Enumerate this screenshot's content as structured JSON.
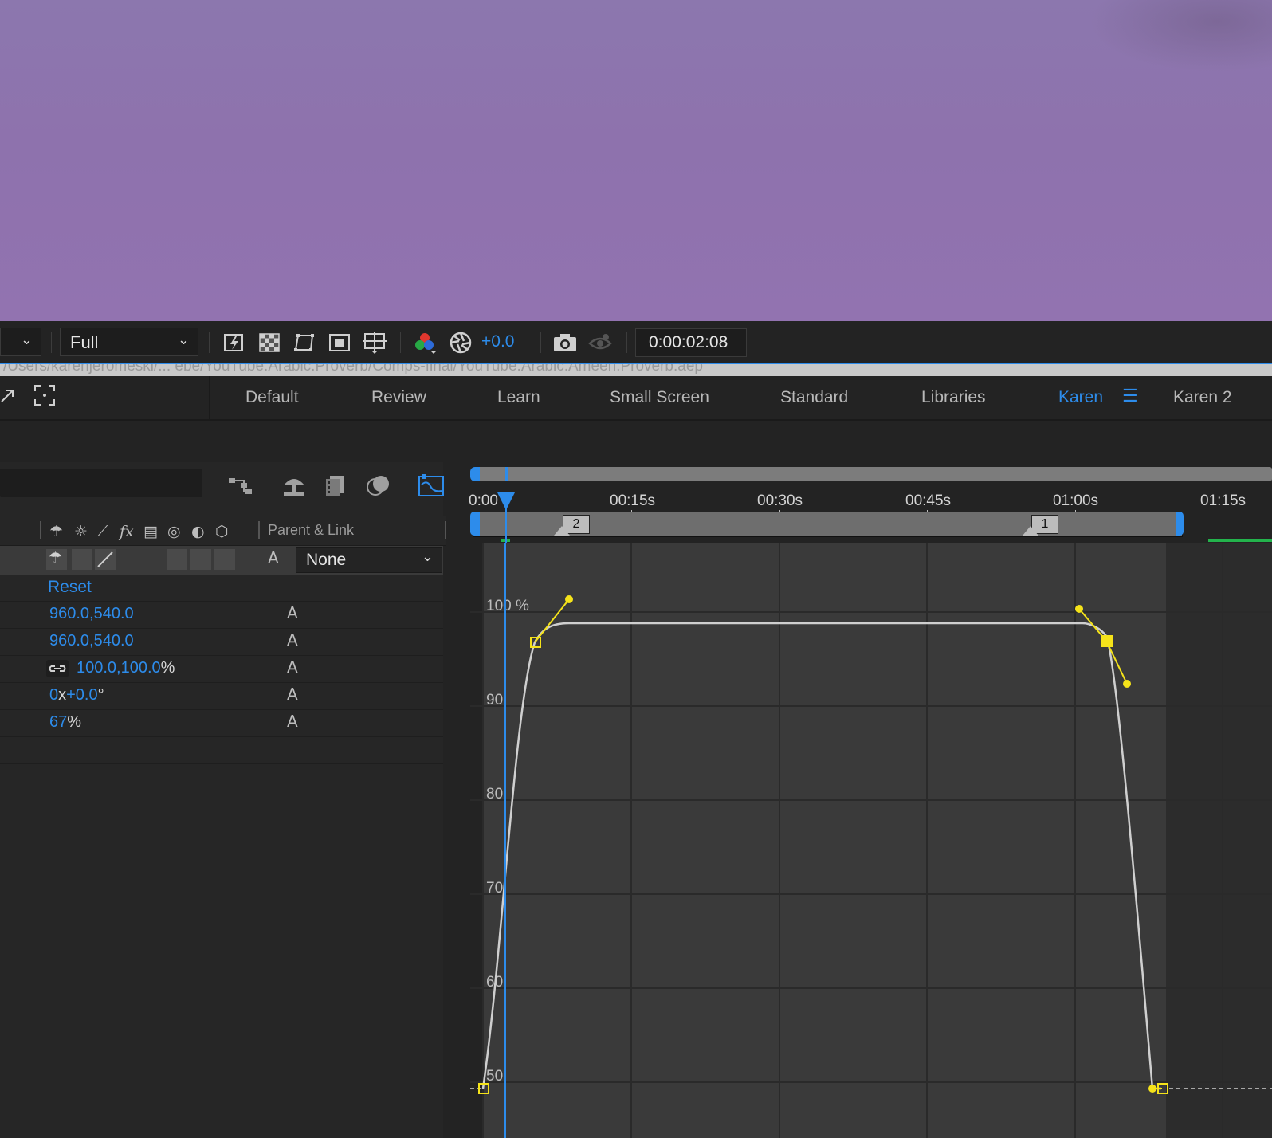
{
  "viewer_toolbar": {
    "resolution": "Full",
    "exposure": "+0.0",
    "current_time": "0:00:02:08"
  },
  "project_path": "/Users/karenjeromeski/... ebe/YouTube.Arabic.Proverb/Comps-final/YouTube.Arabic.Ameen.Proverb.aep",
  "workspaces": [
    {
      "label": "Default"
    },
    {
      "label": "Review"
    },
    {
      "label": "Learn"
    },
    {
      "label": "Small Screen"
    },
    {
      "label": "Standard"
    },
    {
      "label": "Libraries"
    },
    {
      "label": "Karen",
      "active": true
    },
    {
      "label": "Karen 2"
    }
  ],
  "layer_header": {
    "parent_link_label": "Parent & Link"
  },
  "layer": {
    "parent_value": "None"
  },
  "properties": {
    "reset_label": "Reset",
    "anchor_point": "960.0,540.0",
    "position": "960.0,540.0",
    "scale_value": "100.0,100.0",
    "scale_unit": "%",
    "rotation_turns": "0",
    "rotation_x": "x",
    "rotation_degrees": "+0.0",
    "rotation_unit": "°",
    "opacity_value": "67",
    "opacity_unit": "%"
  },
  "ruler": {
    "labels": [
      "0:00",
      "00:15s",
      "00:30s",
      "00:45s",
      "01:00s",
      "01:15s"
    ]
  },
  "markers": [
    {
      "label": "2"
    },
    {
      "label": "1"
    }
  ],
  "graph": {
    "y_labels": [
      "100 %",
      "90",
      "80",
      "70",
      "60",
      "50"
    ],
    "accent": "#f5e31a",
    "curve_color": "#c8c8c8",
    "playhead_color": "#2d8ceb"
  },
  "colors": {
    "accent_blue": "#2d8ceb",
    "panel_bg": "#232323",
    "viewer_purple": "#8e72ad"
  }
}
